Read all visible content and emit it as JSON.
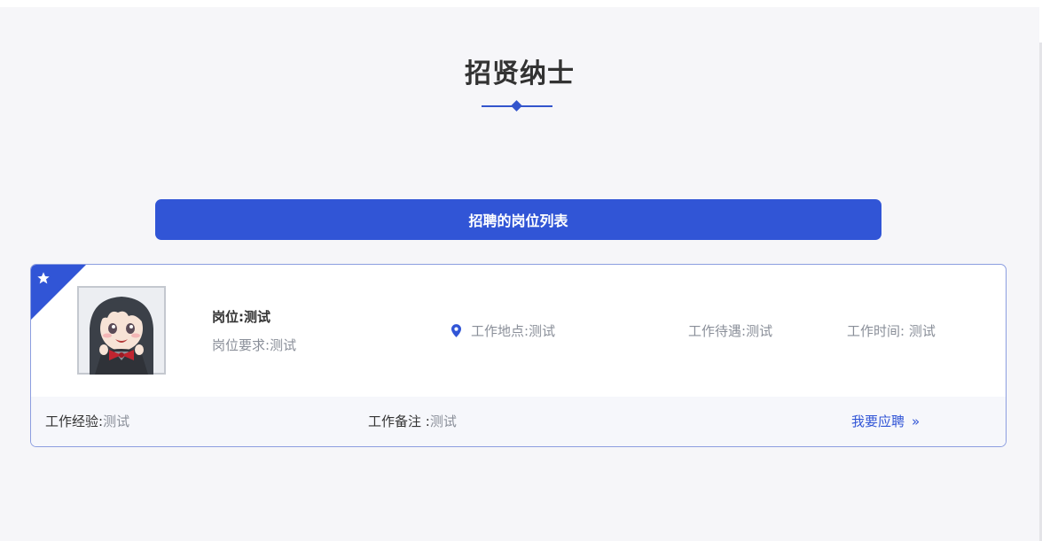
{
  "section": {
    "title": "招贤纳士"
  },
  "list_header": {
    "label": "招聘的岗位列表"
  },
  "job": {
    "title_label": "岗位:",
    "title_value": "测试",
    "requirement_label": "岗位要求:",
    "requirement_value": "测试",
    "location_label": "工作地点:",
    "location_value": "测试",
    "benefits_label": "工作待遇:",
    "benefits_value": "测试",
    "time_label": "工作时间: ",
    "time_value": "测试",
    "experience_label": "工作经验:",
    "experience_value": "测试",
    "remark_label": "工作备注 :",
    "remark_value": "测试",
    "apply_label": "我要应聘",
    "apply_chevron": "»"
  },
  "icons": {
    "corner": "star-icon",
    "location": "map-pin-icon",
    "apply": "double-chevron-right-icon"
  },
  "colors": {
    "accent": "#3155d6",
    "text": "#333333",
    "muted": "#8a8f99",
    "background": "#f6f6f9"
  }
}
